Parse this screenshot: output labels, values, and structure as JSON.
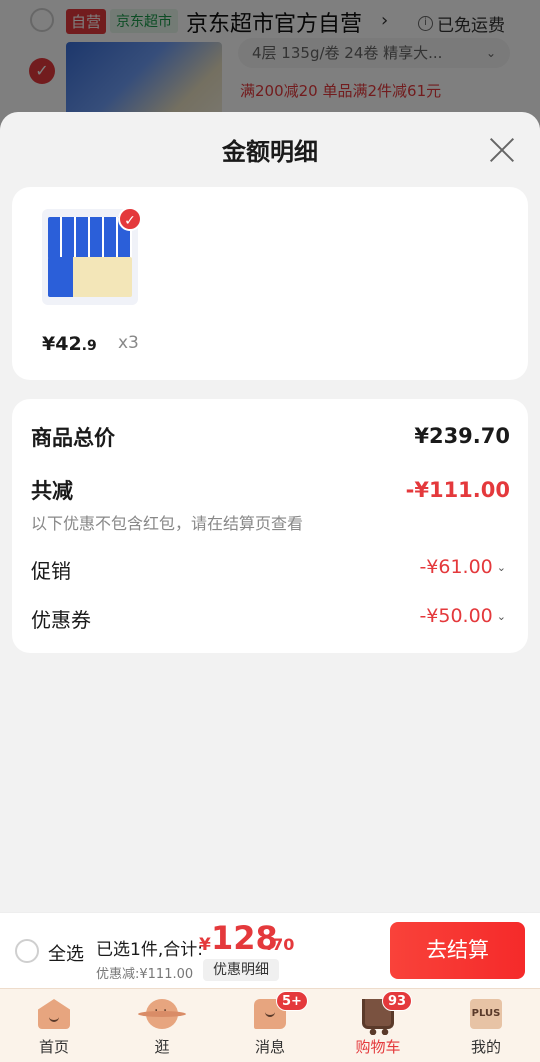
{
  "background_cart": {
    "tag_self": "自营",
    "tag_super": "京东超市",
    "shop_name": "京东超市官方自营",
    "shop_chevron": "›",
    "free_shipping": "已免运费",
    "product_spec": "4层 135g/卷 24卷 精享大...",
    "promo_text": "满200减20  单品满2件减61元"
  },
  "sheet": {
    "title": "金额明细",
    "item": {
      "price_int": "¥42",
      "price_dec": ".9",
      "quantity": "x3"
    },
    "summary": {
      "total_label": "商品总价",
      "total_value": "¥239.70",
      "reduce_label": "共减",
      "reduce_value": "-¥111.00",
      "reduce_note": "以下优惠不包含红包，请在结算页查看",
      "promo_label": "促销",
      "promo_value": "-¥61.00",
      "coupon_label": "优惠券",
      "coupon_value": "-¥50.00"
    }
  },
  "checkout": {
    "select_all": "全选",
    "selected_text": "已选1件,合计:",
    "currency": "¥",
    "total_int": "128",
    "total_dec": ".70",
    "discount_text": "优惠减:¥111.00",
    "detail_button": "优惠明细",
    "checkout_button": "去结算"
  },
  "tabbar": {
    "tabs": [
      {
        "label": "首页",
        "icon": "home-icon"
      },
      {
        "label": "逛",
        "icon": "explore-icon"
      },
      {
        "label": "消息",
        "icon": "message-icon",
        "badge": "5+"
      },
      {
        "label": "购物车",
        "icon": "cart-icon",
        "badge": "93"
      },
      {
        "label": "我的",
        "icon": "plus-icon",
        "icon_text": "PLUS"
      }
    ]
  },
  "colors": {
    "accent_red": "#e4393c",
    "tabbar_bg": "#fbf3ea"
  }
}
